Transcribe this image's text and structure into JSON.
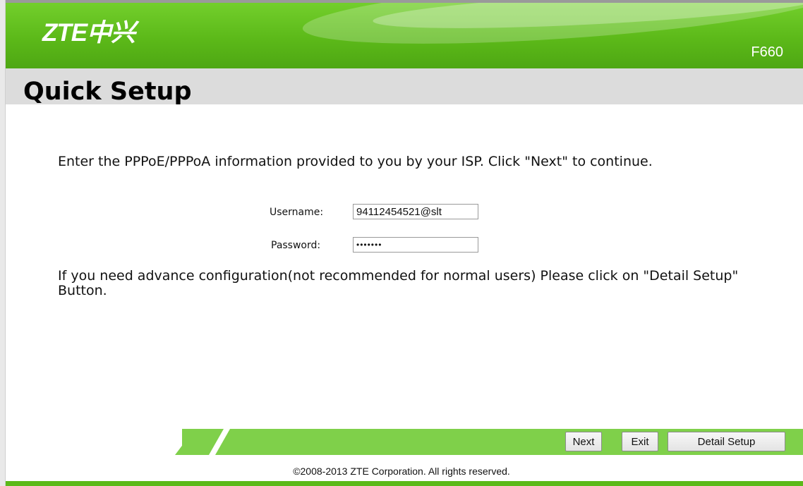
{
  "header": {
    "logo_text": "ZTE中兴",
    "model": "F660",
    "color": "#5cb919"
  },
  "page": {
    "title": "Quick Setup"
  },
  "form": {
    "intro": "Enter the PPPoE/PPPoA information provided to you by your ISP. Click \"Next\" to continue.",
    "username_label": "Username:",
    "username_value": "94112454521@slt",
    "password_label": "Password:",
    "password_value": "•••••••",
    "advice": "If you need advance configuration(not recommended for normal users) Please click on \"Detail Setup\" Button."
  },
  "footer": {
    "next_label": "Next",
    "exit_label": "Exit",
    "detail_label": "Detail Setup",
    "copyright": "©2008-2013 ZTE Corporation. All rights reserved.",
    "bar_color": "#7fd04a"
  }
}
